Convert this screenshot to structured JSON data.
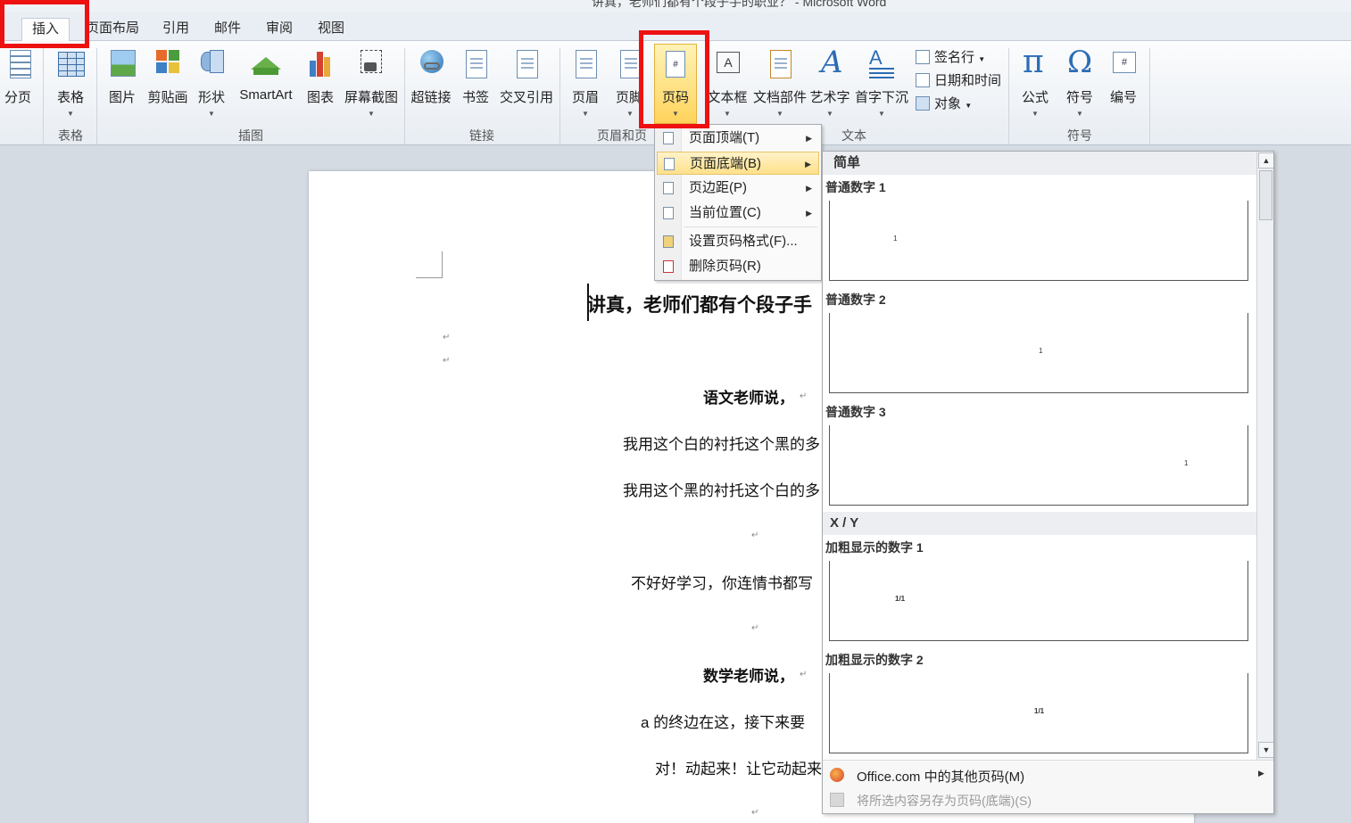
{
  "window": {
    "title": "讲真，老师们都有个段子手的职业？ - Microsoft Word"
  },
  "tabs": [
    {
      "label": "插入",
      "active": true
    },
    {
      "label": "页面布局"
    },
    {
      "label": "引用"
    },
    {
      "label": "邮件"
    },
    {
      "label": "审阅"
    },
    {
      "label": "视图"
    }
  ],
  "ribbon": {
    "buttons": {
      "page_break": "分页",
      "table": "表格",
      "picture": "图片",
      "clipart": "剪贴画",
      "shapes": "形状",
      "smartart": "SmartArt",
      "chart": "图表",
      "screenshot": "屏幕截图",
      "hyperlink": "超链接",
      "bookmark": "书签",
      "cross_ref": "交叉引用",
      "header": "页眉",
      "footer": "页脚",
      "page_number": "页码",
      "textbox": "文本框",
      "quick_parts": "文档部件",
      "wordart": "艺术字",
      "dropcap": "首字下沉",
      "signature": "签名行",
      "datetime": "日期和时间",
      "object": "对象",
      "equation": "公式",
      "symbol": "符号",
      "number": "编号"
    },
    "groups": {
      "tables": "表格",
      "illustrations": "插图",
      "links": "链接",
      "header_footer": "页眉和页脚",
      "text": "文本",
      "symbols": "符号"
    }
  },
  "page_number_menu": {
    "items": [
      "页面顶端(T)",
      "页面底端(B)",
      "页边距(P)",
      "当前位置(C)",
      "设置页码格式(F)...",
      "删除页码(R)"
    ]
  },
  "gallery": {
    "sections": {
      "simple": "简单",
      "xy": "X / Y"
    },
    "items": [
      {
        "label": "普通数字 1",
        "sample": "1"
      },
      {
        "label": "普通数字 2",
        "sample": "1"
      },
      {
        "label": "普通数字 3",
        "sample": "1"
      },
      {
        "label": "加粗显示的数字 1",
        "sample": "1/1"
      },
      {
        "label": "加粗显示的数字 2",
        "sample": "1/1"
      }
    ],
    "footer": {
      "more": "Office.com 中的其他页码(M)",
      "save": "将所选内容另存为页码(底端)(S)"
    }
  },
  "document": {
    "title": "讲真，老师们都有个段子手",
    "lines": [
      "语文老师说，",
      "我用这个白的衬托这个黑的多",
      "我用这个黑的衬托这个白的多",
      "不好好学习，你连情书都写",
      "数学老师说，",
      "a 的终边在这，接下来要",
      "对！动起来！让它动起来"
    ],
    "para_mark": "↵"
  }
}
